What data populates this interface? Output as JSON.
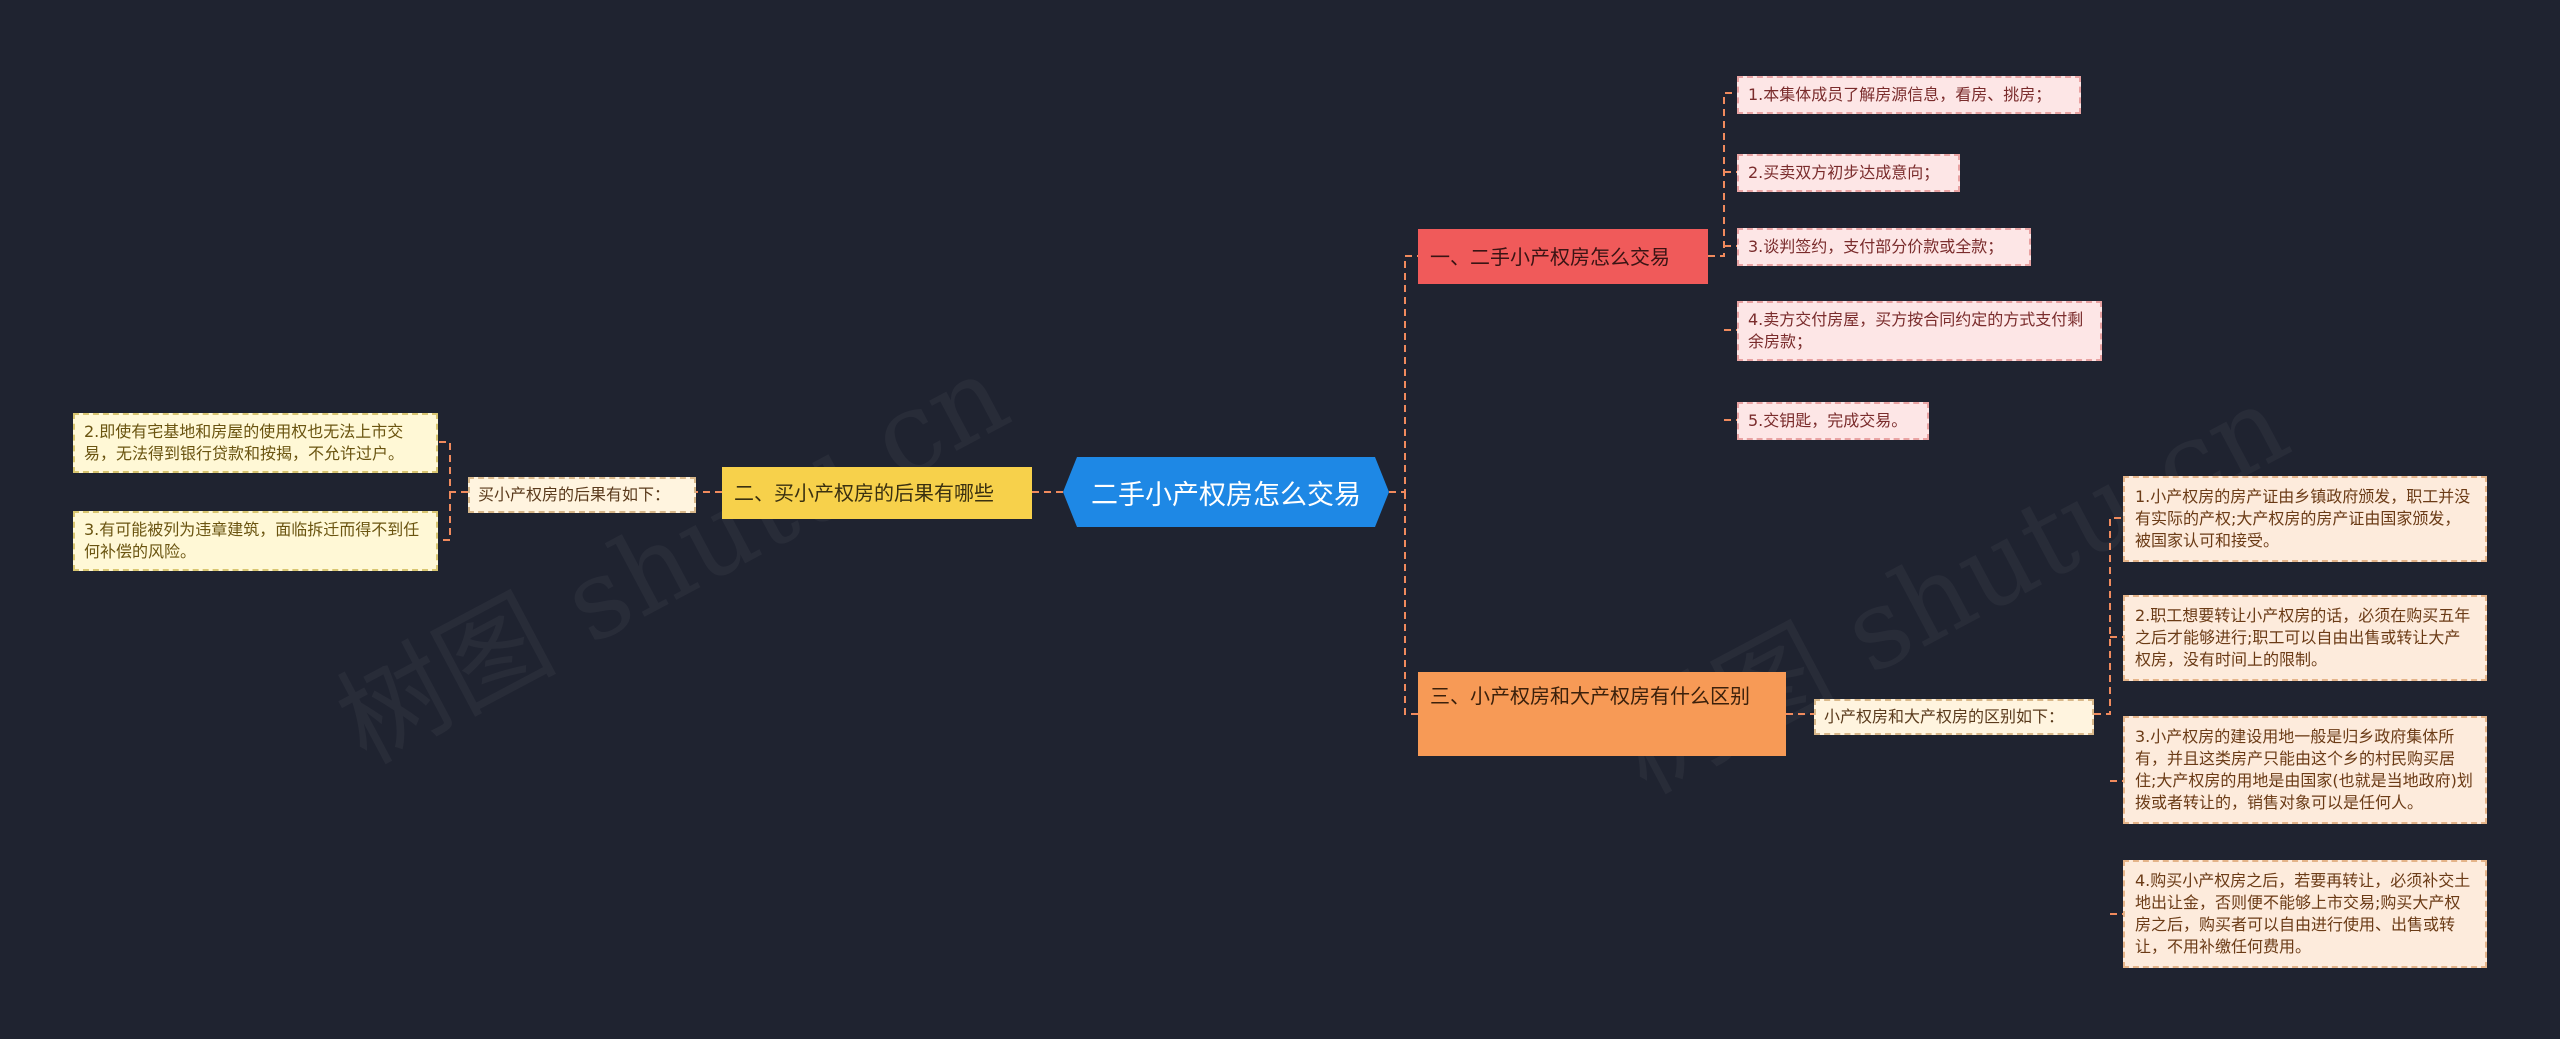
{
  "root": {
    "label": "二手小产权房怎么交易"
  },
  "branches": {
    "trade": {
      "label": "一、二手小产权房怎么交易",
      "color": "#f05a5a",
      "steps": [
        "1.本集体成员了解房源信息，看房、挑房；",
        "2.买卖双方初步达成意向；",
        "3.谈判签约，支付部分价款或全款；",
        "4.卖方交付房屋，买方按合同约定的方式支付剩余房款；",
        "5.交钥匙，完成交易。"
      ]
    },
    "consequences": {
      "label": "二、买小产权房的后果有哪些",
      "color": "#f7d14b",
      "intro": "买小产权房的后果有如下：",
      "items": [
        "2.即使有宅基地和房屋的使用权也无法上市交易，无法得到银行贷款和按揭，不允许过户。",
        "3.有可能被列为违章建筑，面临拆迁而得不到任何补偿的风险。"
      ]
    },
    "difference": {
      "label": "三、小产权房和大产权房有什么区别",
      "color": "#f79a56",
      "intro": "小产权房和大产权房的区别如下：",
      "items": [
        "1.小产权房的房产证由乡镇政府颁发，职工并没有实际的产权;大产权房的房产证由国家颁发，被国家认可和接受。",
        "2.职工想要转让小产权房的话，必须在购买五年之后才能够进行;职工可以自由出售或转让大产权房，没有时间上的限制。",
        "3.小产权房的建设用地一般是归乡政府集体所有，并且这类房产只能由这个乡的村民购买居住;大产权房的用地是由国家(也就是当地政府)划拨或者转让的，销售对象可以是任何人。",
        "4.购买小产权房之后，若要再转让，必须补交土地出让金，否则便不能够上市交易;购买大产权房之后，购买者可以自由进行使用、出售或转让，不用补缴任何费用。"
      ]
    }
  },
  "watermark": "树图 shutu.cn",
  "connector_color": "#f08a5d"
}
